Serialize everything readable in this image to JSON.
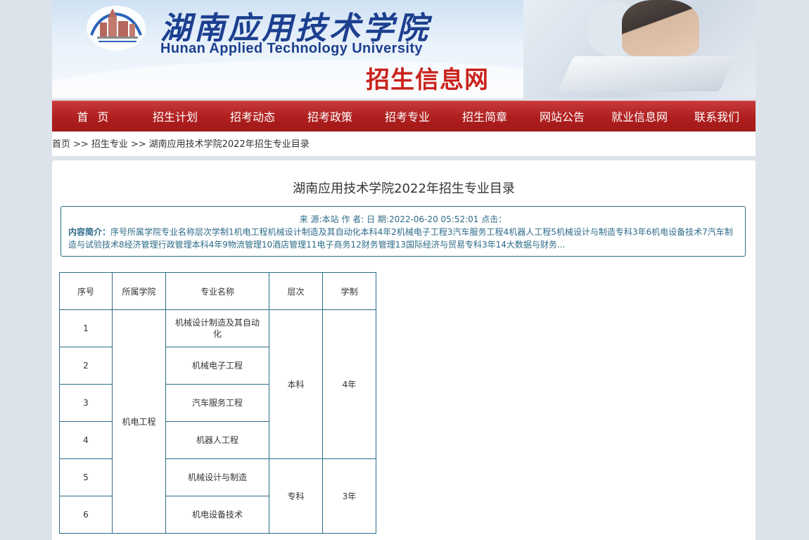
{
  "banner": {
    "cn_name": "湖南应用技术学院",
    "en_name": "Hunan Applied Technology University",
    "portal_name": "招生信息网"
  },
  "nav": [
    "首 页",
    "招生计划",
    "招考动态",
    "招考政策",
    "招考专业",
    "招生简章",
    "网站公告",
    "就业信息网",
    "联系我们"
  ],
  "breadcrumb": {
    "home": "首页",
    "sep": ">>",
    "section": "招生专业",
    "current": "湖南应用技术学院2022年招生专业目录"
  },
  "article": {
    "title": "湖南应用技术学院2022年招生专业目录",
    "meta": "来 源:本站 作 者: 日 期:2022-06-20 05:52:01 点击：",
    "intro_label": "内容简介：",
    "intro_text": "序号所属学院专业名称层次学制1机电工程机械设计制造及其自动化本科4年2机械电子工程3汽车服务工程4机器人工程5机械设计与制造专科3年6机电设备技术7汽车制造与试验技术8经济管理行政管理本科4年9物流管理10酒店管理11电子商务12财务管理13国际经济与贸易专科3年14大数据与财务..."
  },
  "table": {
    "headers": [
      "序号",
      "所属学院",
      "专业名称",
      "层次",
      "学制"
    ],
    "college": "机电工程",
    "rows": [
      {
        "no": "1",
        "major": "机械设计制造及其自动化"
      },
      {
        "no": "2",
        "major": "机械电子工程"
      },
      {
        "no": "3",
        "major": "汽车服务工程"
      },
      {
        "no": "4",
        "major": "机器人工程"
      },
      {
        "no": "5",
        "major": "机械设计与制造"
      },
      {
        "no": "6",
        "major": "机电设备技术"
      }
    ],
    "level_a": "本科",
    "duration_a": "4年",
    "level_b": "专科",
    "duration_b": "3年"
  },
  "colors": {
    "nav_red": "#b01f1f",
    "title_blue": "#1c3f8f",
    "portal_red": "#c8231d",
    "border_teal": "#2d6b88"
  }
}
